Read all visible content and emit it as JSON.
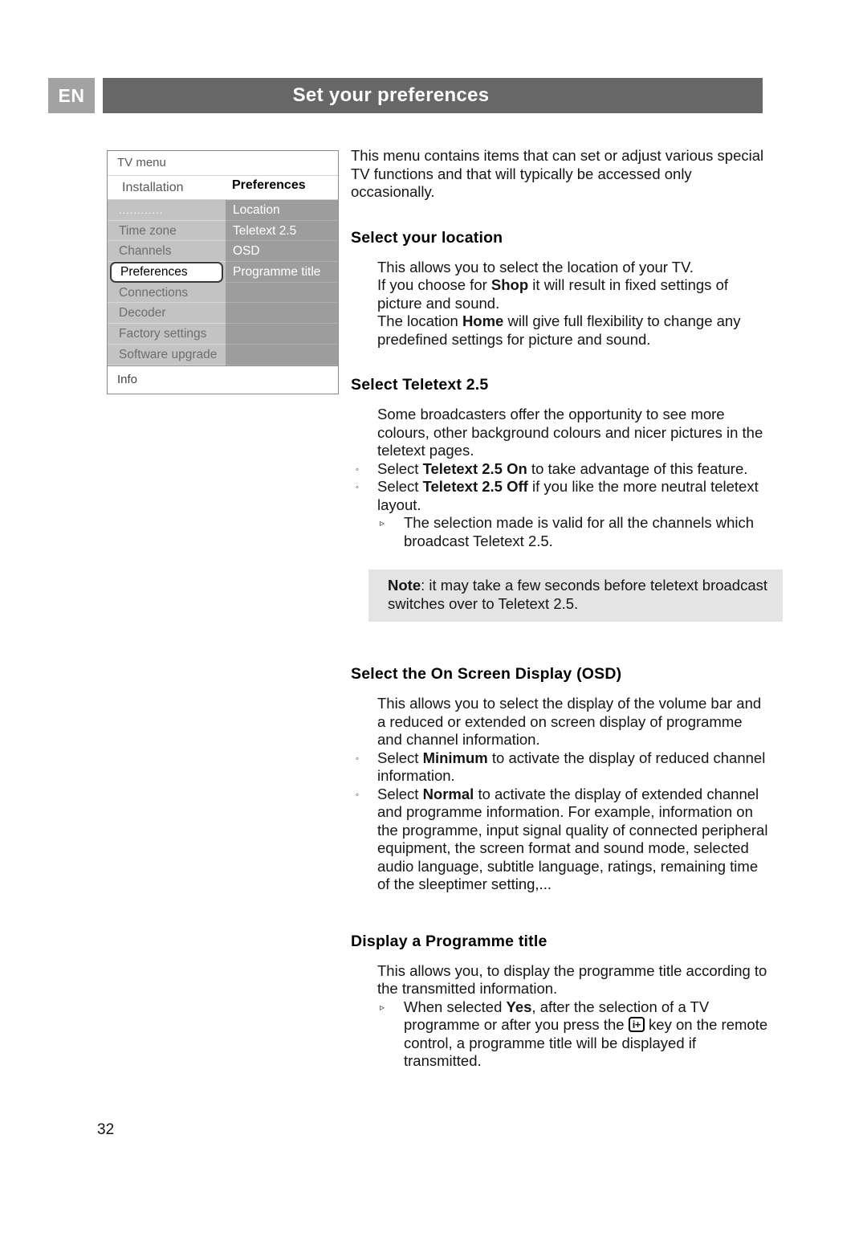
{
  "header": {
    "language": "EN",
    "title": "Set your preferences"
  },
  "tv_menu": {
    "title": "TV menu",
    "sub_left": "Installation",
    "sub_right": "Preferences",
    "left_items": [
      "............",
      "Time zone",
      "Channels",
      "Preferences",
      "Connections",
      "Decoder",
      "Factory settings",
      "Software upgrade"
    ],
    "selected_left_item": "Preferences",
    "right_items": [
      "Location",
      "Teletext 2.5",
      "OSD",
      "Programme title"
    ],
    "info_label": "Info"
  },
  "content": {
    "intro": "This menu contains items that can set or adjust various special TV functions and that will typically be accessed only occasionally.",
    "section_location": {
      "heading": "Select your location",
      "line1": "This allows you to select the location of your TV.",
      "line2_a": "If you choose for ",
      "line2_b": "Shop",
      "line2_c": " it will result in fixed settings of picture and sound.",
      "line3_a": "The location ",
      "line3_b": "Home",
      "line3_c": " will give full flexibility to change any predefined settings for picture and sound."
    },
    "section_teletext": {
      "heading": "Select Teletext 2.5",
      "para": "Some broadcasters offer the opportunity to see more colours, other background colours and nicer pictures in the teletext pages.",
      "bullet1_a": "Select ",
      "bullet1_b": "Teletext 2.5 On",
      "bullet1_c": " to take advantage of this feature.",
      "bullet2_a": "Select ",
      "bullet2_b": "Teletext 2.5 Off",
      "bullet2_c": " if you like the more neutral teletext layout.",
      "subbullet1": "The selection made is valid for all the channels which broadcast Teletext 2.5.",
      "bullet_marker": "◦",
      "subbullet_marker": "▹"
    },
    "note": {
      "label": "Note",
      "text": ": it may take a few seconds before teletext broadcast switches over to Teletext 2.5."
    },
    "section_osd": {
      "heading": "Select the On Screen Display (OSD)",
      "para": "This allows you to select the display of the volume bar and a reduced or extended on screen display of programme and channel information.",
      "bullet1_a": "Select ",
      "bullet1_b": "Minimum",
      "bullet1_c": " to activate the display of reduced channel information.",
      "bullet2_a": "Select ",
      "bullet2_b": "Normal",
      "bullet2_c": " to activate the display of extended channel and programme information. For example, information on the programme, input signal quality of connected peripheral equipment, the screen format and sound mode, selected audio language, subtitle language, ratings, remaining time of the sleeptimer setting,..."
    },
    "section_programme_title": {
      "heading": "Display a Programme title",
      "para": "This allows you, to display the programme title according to the transmitted information.",
      "subbullet_a": "When selected ",
      "subbullet_b": "Yes",
      "subbullet_c": ", after the selection of a TV programme or after you press the ",
      "key_label": "i+",
      "subbullet_d": " key on the remote control, a  programme title will be displayed if transmitted."
    }
  },
  "page_number": "32",
  "colors": {
    "header_bar": "#676767",
    "lang_box": "#a2a2a2",
    "menu_left_column": "#c3c3c3",
    "menu_right_column": "#9d9d9d",
    "note_background": "#e4e4e4"
  }
}
